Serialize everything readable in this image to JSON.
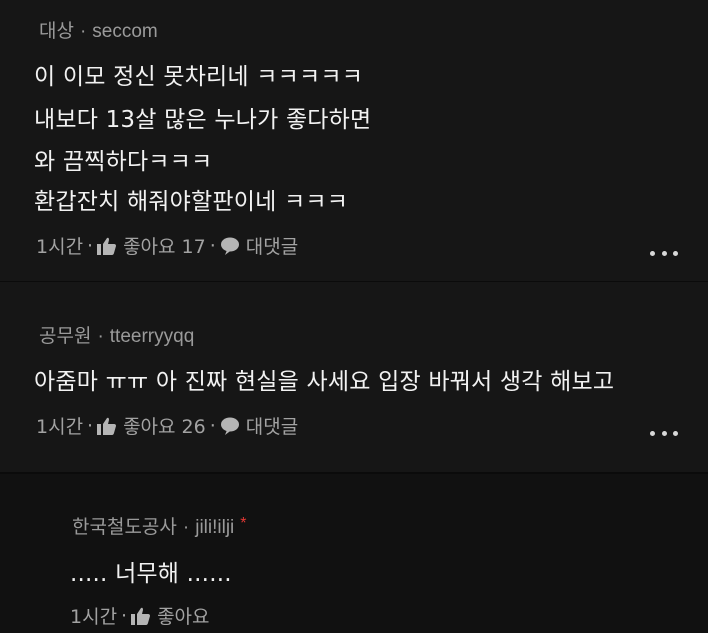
{
  "comments": [
    {
      "author": "대상",
      "handle": "seccom",
      "lines": [
        "이 이모 정신 못차리네 ㅋㅋㅋㅋㅋ",
        "내보다 13살 많은 누나가 좋다하면",
        "와 끔찍하다ㅋㅋㅋ",
        "환갑잔치 해줘야할판이네 ㅋㅋㅋ"
      ],
      "time": "1시간",
      "like_label": "좋아요 17",
      "reply_label": "대댓글"
    },
    {
      "author": "공무원",
      "handle": "tteerryyqq",
      "lines": [
        "아줌마 ㅠㅠ 아 진짜 현실을 사세요  입장 바꿔서 생각 해보고"
      ],
      "time": "1시간",
      "like_label": "좋아요 26",
      "reply_label": "대댓글"
    },
    {
      "author": "한국철도공사",
      "handle": "jili!ilji",
      "star": "*",
      "lines": [
        "..... 너무해 ......"
      ],
      "time": "1시간",
      "like_label": "좋아요"
    }
  ],
  "separator_dot": "·",
  "colors": {
    "background": "#161616",
    "reply_background": "#111111",
    "meta_text": "#9a9a9a",
    "body_text": "#f2f2f2",
    "star": "#e53935"
  },
  "icons": {
    "like": "thumbs-up-icon",
    "reply": "speech-bubble-icon",
    "more": "more-dots-icon"
  }
}
